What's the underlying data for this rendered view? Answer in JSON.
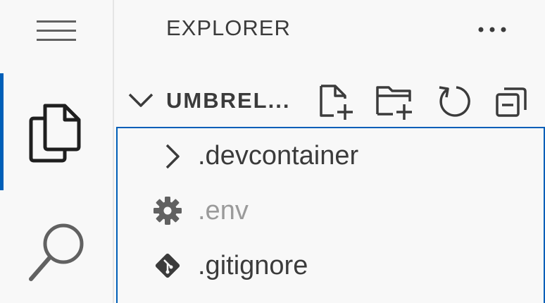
{
  "activity_bar": {
    "items": [
      {
        "id": "explorer",
        "icon": "files-icon",
        "active": true
      },
      {
        "id": "search",
        "icon": "search-icon",
        "active": false
      }
    ],
    "accent_color": "#005fb8"
  },
  "sidebar": {
    "title": "EXPLORER",
    "more_actions_label": "···",
    "folder": {
      "name": "UMBREL...",
      "expanded": true,
      "actions": [
        "new-file-icon",
        "new-folder-icon",
        "refresh-icon",
        "collapse-all-icon"
      ]
    },
    "tree": [
      {
        "name": ".devcontainer",
        "type": "folder",
        "icon": "chevron-right-icon"
      },
      {
        "name": ".env",
        "type": "file",
        "icon": "gear-icon",
        "dimmed": true
      },
      {
        "name": ".gitignore",
        "type": "file",
        "icon": "git-icon",
        "dimmed": false
      }
    ]
  }
}
